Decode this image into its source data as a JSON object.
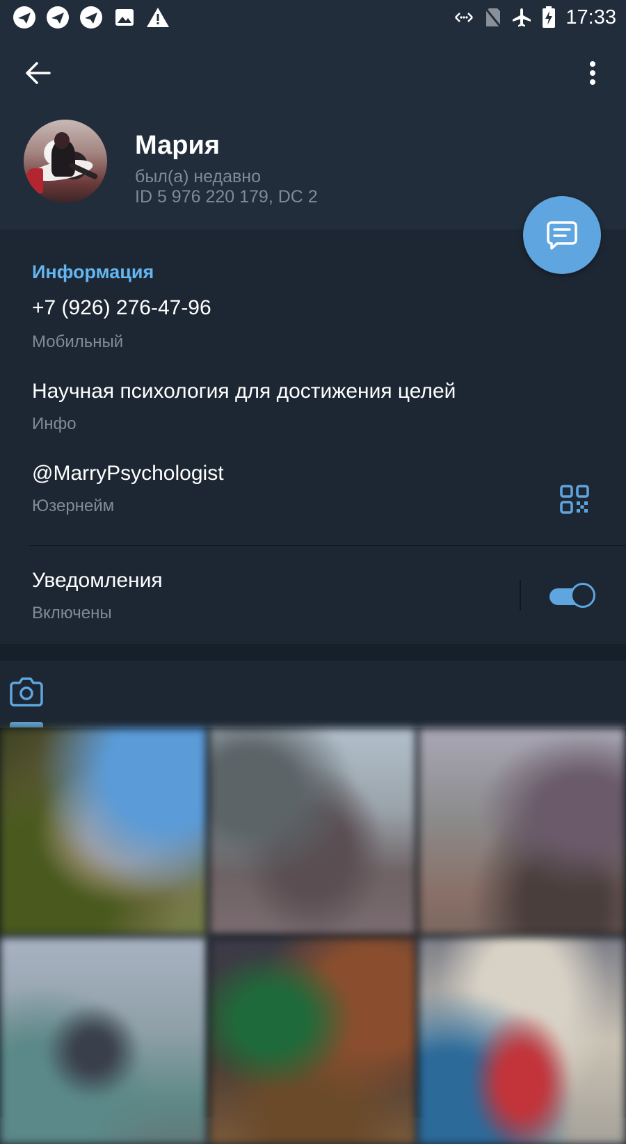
{
  "status_bar": {
    "time": "17:33",
    "left_icons": [
      "app-icon",
      "app-icon",
      "app-icon",
      "image-icon",
      "warning-icon"
    ],
    "right_icons": [
      "data-sync-icon",
      "no-sim-icon",
      "airplane-icon",
      "battery-charging-icon"
    ]
  },
  "profile": {
    "name": "Мария",
    "status": "был(а) недавно",
    "id_line": "ID 5 976 220 179, DC 2"
  },
  "info": {
    "section_title": "Информация",
    "phone": {
      "value": "+7 (926) 276-47-96",
      "label": "Мобильный"
    },
    "bio": {
      "value": "Научная психология для достижения целей",
      "label": "Инфо"
    },
    "username": {
      "value": "@MarryPsychologist",
      "label": "Юзернейм"
    },
    "notifications": {
      "value": "Уведомления",
      "label": "Включены",
      "enabled": true
    }
  },
  "media": {
    "active_tab": "photos",
    "photos_count_visible": 6
  },
  "colors": {
    "accent": "#5fa6e0",
    "header_bg": "#212d3b",
    "content_bg": "#1d2733",
    "secondary_text": "#7f8b98",
    "section_title": "#64b5f0"
  }
}
